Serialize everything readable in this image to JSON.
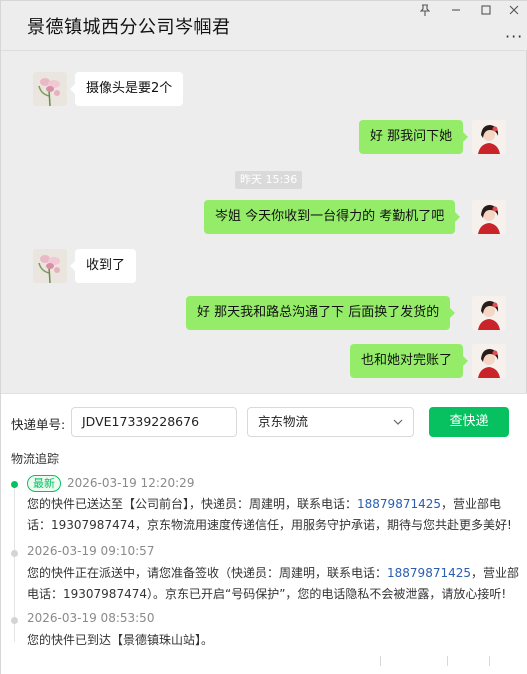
{
  "window": {
    "title": "景德镇城西分公司岑帼君"
  },
  "controls": {
    "more": "···"
  },
  "chat": {
    "messages": [
      {
        "side": "left",
        "text": "摄像头是要2个"
      },
      {
        "side": "right",
        "text": "好 那我问下她"
      },
      {
        "side": "right",
        "text": "岑姐  今天你收到一台得力的 考勤机了吧"
      },
      {
        "side": "left",
        "text": "收到了"
      },
      {
        "side": "right",
        "text": "好  那天我和路总沟通了下  后面换了发货的"
      },
      {
        "side": "right",
        "text": "也和她对完账了"
      }
    ],
    "timestamp": "昨天 15:36"
  },
  "express": {
    "label": "快递单号:",
    "tracking_number": "JDVE17339228676",
    "carrier": "京东物流",
    "query_button": "查快递",
    "section_title": "物流追踪",
    "latest_badge": "最新",
    "events": [
      {
        "time": "2026-03-19 12:20:29",
        "line1_a": "您的快件已送达至【公司前台】，快递员：周建明，联系电话：",
        "line1_phone": "18879871425",
        "line1_b": "，营业部电",
        "line2": "话：19307987474，京东物流用速度传递信任，用服务守护承诺，期待与您共赴更多美好!"
      },
      {
        "time": "2026-03-19 09:10:57",
        "line1_a": "您的快件正在派送中，请您准备签收（快递员：周建明，联系电话：",
        "line1_phone": "18879871425",
        "line1_b": "，营业部",
        "line2": "电话：19307987474）。京东已开启“号码保护”，您的电话隐私不会被泄露，请放心接听!"
      },
      {
        "time": "2026-03-19 08:53:50",
        "line1_a": "您的快件已到达【景德镇珠山站】。",
        "line1_phone": "",
        "line1_b": "",
        "line2": ""
      }
    ]
  },
  "colors": {
    "accent": "#07c160",
    "bubble_self": "#95ec69",
    "phone_link": "#2a5db0"
  }
}
